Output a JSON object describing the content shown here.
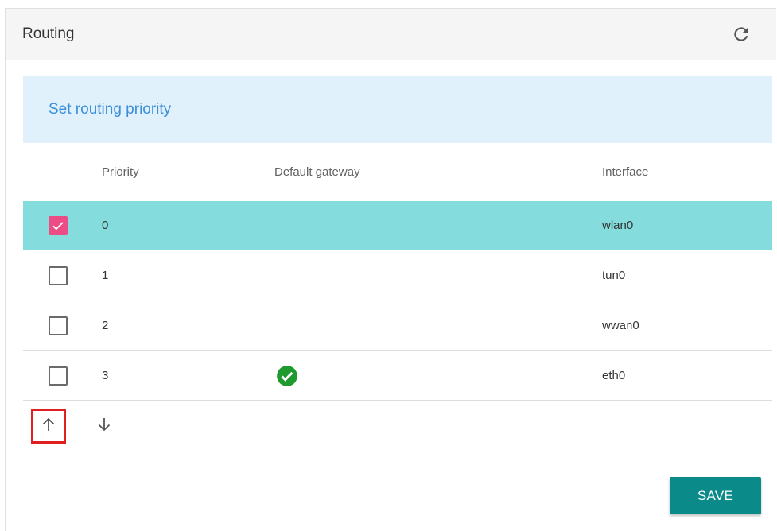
{
  "header": {
    "title": "Routing",
    "refresh_icon": "refresh-icon"
  },
  "banner": {
    "text": "Set routing priority"
  },
  "table": {
    "columns": {
      "priority": "Priority",
      "default_gateway": "Default gateway",
      "interface": "Interface"
    },
    "rows": [
      {
        "checked": true,
        "priority": "0",
        "default_gateway": false,
        "interface": "wlan0"
      },
      {
        "checked": false,
        "priority": "1",
        "default_gateway": false,
        "interface": "tun0"
      },
      {
        "checked": false,
        "priority": "2",
        "default_gateway": false,
        "interface": "wwan0"
      },
      {
        "checked": false,
        "priority": "3",
        "default_gateway": true,
        "interface": "eth0"
      }
    ]
  },
  "controls": {
    "move_up_icon": "arrow-up-icon",
    "move_down_icon": "arrow-down-icon",
    "save_label": "SAVE"
  },
  "colors": {
    "selected_row": "#85dcdc",
    "checkbox_checked": "#ec4c86",
    "save_button": "#0b8a8a",
    "banner_bg": "#e1f1fc",
    "banner_text": "#3b8fd9",
    "gateway_check": "#1e9a2e",
    "highlight_border": "#e02020"
  }
}
